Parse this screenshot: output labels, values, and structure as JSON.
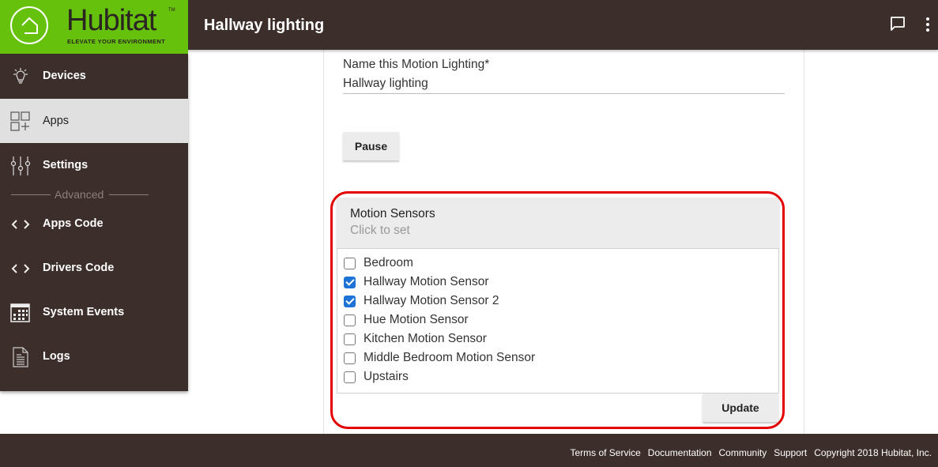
{
  "brand": {
    "name": "Hubitat",
    "tagline": "ELEVATE YOUR ENVIRONMENT",
    "trademark": "TM",
    "color_green": "#66c10c",
    "color_dark": "#3c2e2b"
  },
  "header": {
    "title": "Hallway lighting",
    "icons": [
      "chat-icon",
      "more-vert-icon"
    ]
  },
  "sidebar": {
    "items": [
      {
        "label": "Devices",
        "icon": "lightbulb-icon",
        "active": false
      },
      {
        "label": "Apps",
        "icon": "apps-icon",
        "active": true
      },
      {
        "label": "Settings",
        "icon": "sliders-icon",
        "active": false
      }
    ],
    "section_label": "Advanced",
    "advanced_items": [
      {
        "label": "Apps Code",
        "icon": "code-icon"
      },
      {
        "label": "Drivers Code",
        "icon": "code-icon"
      },
      {
        "label": "System Events",
        "icon": "calendar-icon"
      },
      {
        "label": "Logs",
        "icon": "document-icon"
      }
    ]
  },
  "form": {
    "name_label": "Name this Motion Lighting*",
    "name_value": "Hallway lighting",
    "pause_label": "Pause",
    "selector": {
      "title": "Motion Sensors",
      "subtitle": "Click to set",
      "options": [
        {
          "label": "Bedroom",
          "checked": false
        },
        {
          "label": "Hallway Motion Sensor",
          "checked": true
        },
        {
          "label": "Hallway Motion Sensor 2",
          "checked": true
        },
        {
          "label": "Hue Motion Sensor",
          "checked": false
        },
        {
          "label": "Kitchen Motion Sensor",
          "checked": false
        },
        {
          "label": "Middle Bedroom Motion Sensor",
          "checked": false
        },
        {
          "label": "Upstairs",
          "checked": false
        }
      ],
      "update_label": "Update",
      "highlight_color": "#e50000",
      "checkbox_color": "#1e73d6"
    }
  },
  "footer": {
    "links": [
      "Terms of Service",
      "Documentation",
      "Community",
      "Support"
    ],
    "copyright": "Copyright 2018 Hubitat, Inc."
  }
}
